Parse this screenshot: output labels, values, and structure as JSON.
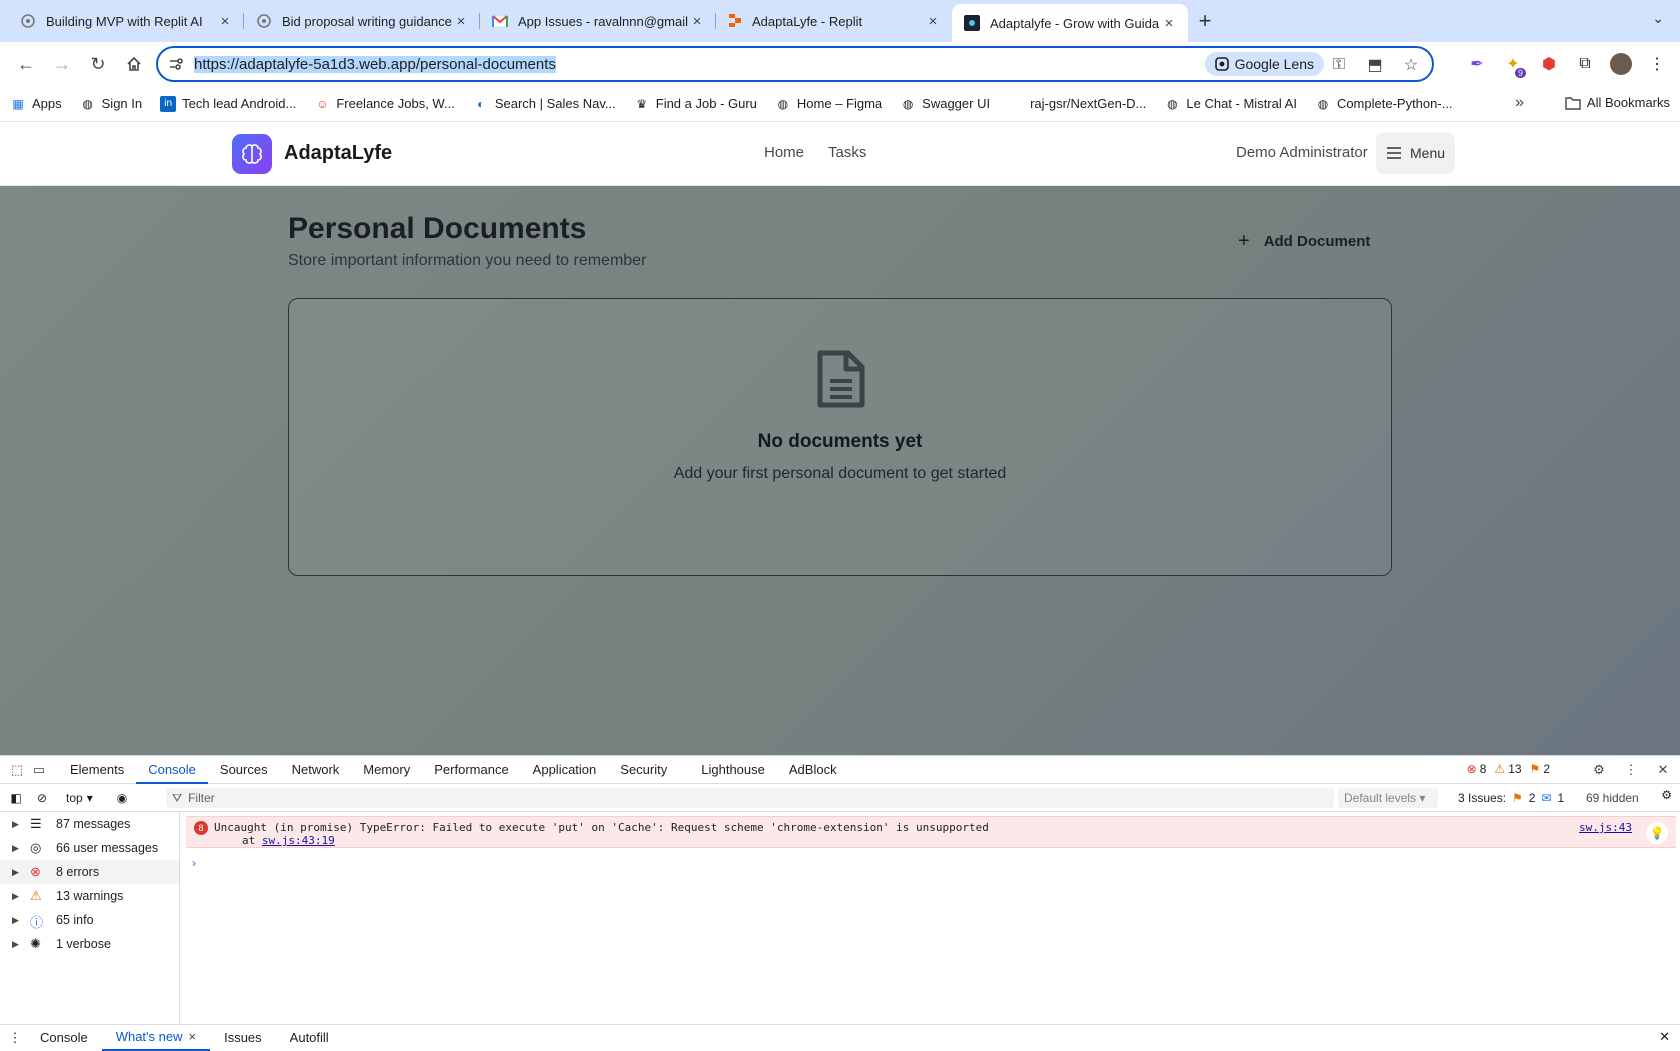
{
  "browser": {
    "tabs": [
      {
        "title": "Building MVP with Replit AI",
        "icon": "openai-icon"
      },
      {
        "title": "Bid proposal writing guidance",
        "icon": "openai-icon"
      },
      {
        "title": "App Issues - ravalnnn@gmail",
        "icon": "gmail-icon"
      },
      {
        "title": "AdaptaLyfe - Replit",
        "icon": "replit-icon"
      },
      {
        "title": "Adaptalyfe - Grow with Guida",
        "icon": "app-icon",
        "active": true
      }
    ],
    "url": "https://adaptalyfe-5a1d3.web.app/personal-documents",
    "google_lens_label": "Google Lens",
    "extension_badge": "9",
    "bookmarks": [
      {
        "label": "Apps",
        "icon": "grid-icon"
      },
      {
        "label": "Sign In",
        "icon": "globe-icon"
      },
      {
        "label": "Tech lead Android...",
        "icon": "linkedin-icon"
      },
      {
        "label": "Freelance Jobs, W...",
        "icon": "freelancer-icon"
      },
      {
        "label": "Search | Sales Nav...",
        "icon": "compass-icon"
      },
      {
        "label": "Find a Job - Guru",
        "icon": "guru-icon"
      },
      {
        "label": "Home – Figma",
        "icon": "globe-icon"
      },
      {
        "label": "Swagger UI",
        "icon": "globe-icon"
      },
      {
        "label": "raj-gsr/NextGen-D...",
        "icon": "github-icon"
      },
      {
        "label": "Le Chat - Mistral AI",
        "icon": "globe-icon"
      },
      {
        "label": "Complete-Python-...",
        "icon": "globe-icon"
      }
    ],
    "all_bookmarks_label": "All Bookmarks"
  },
  "app": {
    "brand": "AdaptaLyfe",
    "nav": [
      "Home",
      "Tasks"
    ],
    "user_name": "Demo Administrator",
    "menu_label": "Menu",
    "page_title": "Personal Documents",
    "page_subtitle": "Store important information you need to remember",
    "add_button_label": "Add Document",
    "empty_title": "No documents yet",
    "empty_subtitle": "Add your first personal document to get started"
  },
  "devtools": {
    "tabs": [
      "Elements",
      "Console",
      "Sources",
      "Network",
      "Memory",
      "Performance",
      "Application",
      "Security",
      "Lighthouse",
      "AdBlock"
    ],
    "active_tab": "Console",
    "counts": {
      "errors": "8",
      "warnings": "13",
      "issues": "2"
    },
    "context": "top",
    "filter_placeholder": "Filter",
    "levels_label": "Default levels",
    "issues_label": "3 Issues:",
    "issues_warn": "2",
    "issues_info": "1",
    "hidden_label": "69 hidden",
    "sidebar": [
      {
        "label": "87 messages",
        "icon": "list-icon"
      },
      {
        "label": "66 user messages",
        "icon": "user-icon"
      },
      {
        "label": "8 errors",
        "icon": "error-icon"
      },
      {
        "label": "13 warnings",
        "icon": "warning-icon"
      },
      {
        "label": "65 info",
        "icon": "info-icon"
      },
      {
        "label": "1 verbose",
        "icon": "bug-icon"
      }
    ],
    "error": {
      "count": "8",
      "message": "Uncaught (in promise) TypeError: Failed to execute 'put' on 'Cache': Request scheme 'chrome-extension' is unsupported",
      "at_prefix": "at",
      "at_link": "sw.js:43:19",
      "source": "sw.js:43"
    },
    "drawer_tabs": [
      "Console",
      "What's new",
      "Issues",
      "Autofill"
    ],
    "drawer_active": "What's new"
  },
  "colors": {
    "accent": "#0b57d0",
    "brand_gradient_start": "#4f6ef7",
    "brand_gradient_end": "#8b3ff0",
    "error": "#dc362e"
  }
}
